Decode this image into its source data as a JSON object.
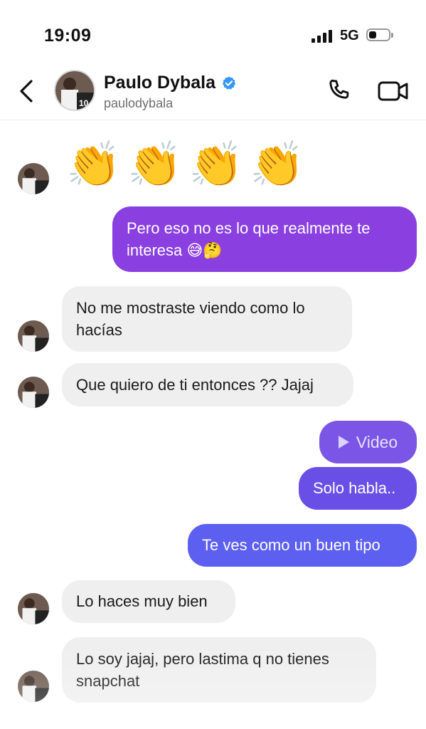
{
  "status_bar": {
    "time": "19:09",
    "network": "5G",
    "battery_level": 0.35
  },
  "header": {
    "contact_name": "Paulo Dybala",
    "handle": "paulodybala",
    "icons": {
      "back": "chevron-left-icon",
      "verified": "verified-badge-icon",
      "call": "phone-icon",
      "video": "video-camera-icon"
    },
    "accent": "#3897f0"
  },
  "messages": [
    {
      "from": "them",
      "type": "emoji",
      "text": "👏🏼👏🏼👏🏼👏🏼"
    },
    {
      "from": "me",
      "type": "text",
      "text": "Pero eso no es lo que realmente te interesa 😅🤔"
    },
    {
      "from": "them",
      "type": "text",
      "text": "No me mostraste viendo como lo hacías"
    },
    {
      "from": "them",
      "type": "text",
      "text": "Que quiero de ti entonces ?? Jajaj"
    },
    {
      "from": "me",
      "type": "video",
      "text": "Video"
    },
    {
      "from": "me",
      "type": "text",
      "text": "Solo habla.."
    },
    {
      "from": "me",
      "type": "text",
      "text": "Te ves como un buen tipo"
    },
    {
      "from": "them",
      "type": "text",
      "text": "Lo haces muy bien"
    },
    {
      "from": "them",
      "type": "text",
      "text": "Lo soy jajaj, pero lastima q no tienes snapchat"
    }
  ],
  "colors": {
    "incoming_bubble": "#efefef",
    "outgoing_purple": "#8a3fe0",
    "outgoing_violet": "#6a4fe6",
    "outgoing_blue": "#5c5ff0"
  }
}
